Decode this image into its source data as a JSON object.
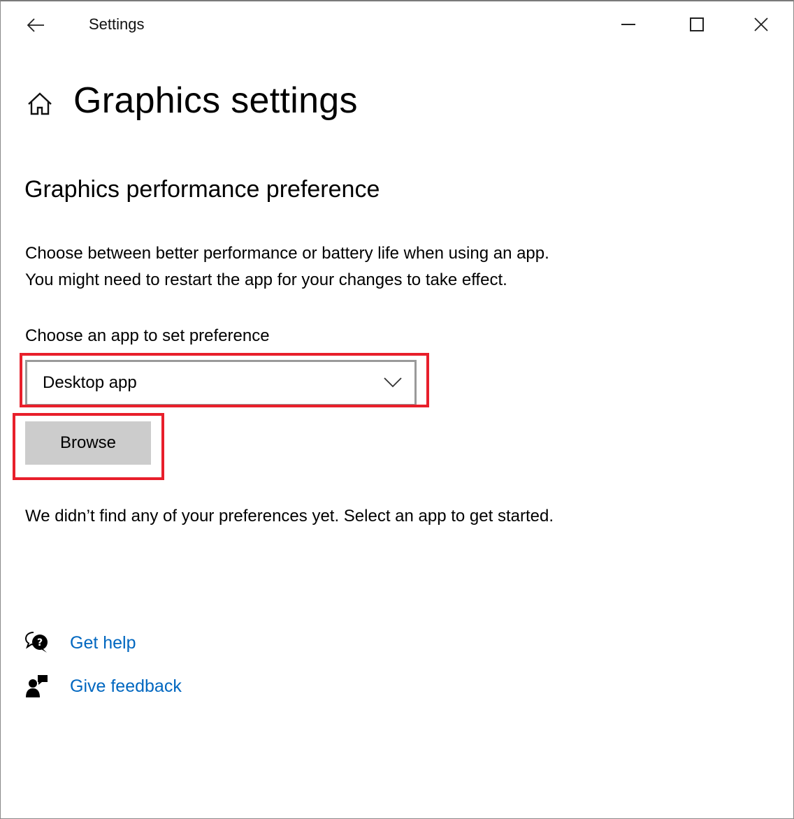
{
  "window": {
    "title": "Settings",
    "controls": {
      "minimize": "minimize-icon",
      "maximize": "maximize-icon",
      "close": "close-icon"
    },
    "back_icon": "back-arrow-icon"
  },
  "header": {
    "home_icon": "home-icon",
    "title": "Graphics settings"
  },
  "section": {
    "title": "Graphics performance preference",
    "description_line1": "Choose between better performance or battery life when using an app.",
    "description_line2": "You might need to restart the app for your changes to take effect."
  },
  "app_picker": {
    "label": "Choose an app to set preference",
    "selected": "Desktop app",
    "browse_label": "Browse"
  },
  "empty_state": "We didn’t find any of your preferences yet. Select an app to get started.",
  "links": [
    {
      "icon": "get-help-icon",
      "label": "Get help"
    },
    {
      "icon": "give-feedback-icon",
      "label": "Give feedback"
    }
  ],
  "colors": {
    "link": "#0067c0",
    "highlight": "#e81f2b",
    "button_bg": "#cccccc"
  }
}
